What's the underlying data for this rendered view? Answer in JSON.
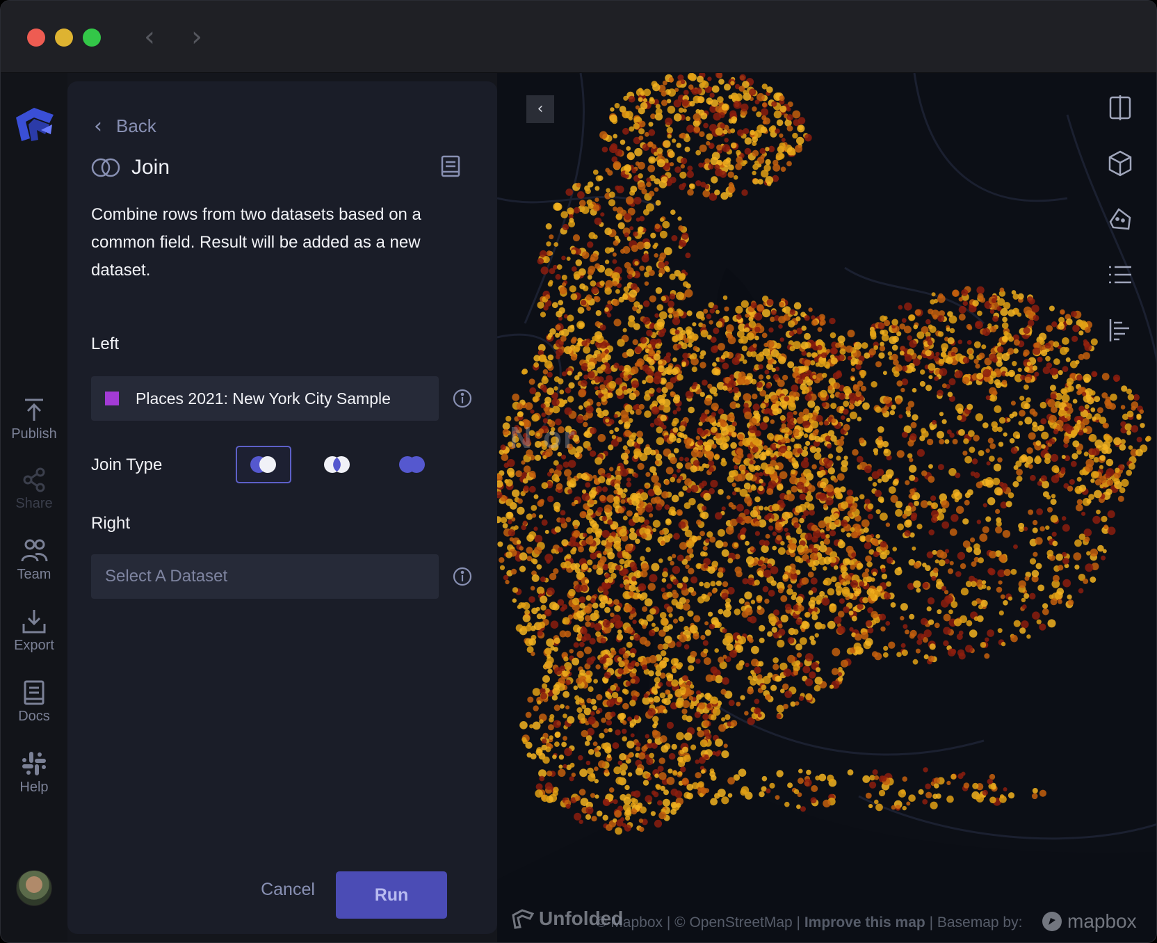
{
  "window": {
    "traffic_lights": [
      "close",
      "minimize",
      "zoom"
    ],
    "nav": {
      "back_glyph": "‹",
      "forward_glyph": "›"
    }
  },
  "rail": {
    "items": [
      {
        "label": "Publish",
        "icon": "upload-icon",
        "enabled": true
      },
      {
        "label": "Share",
        "icon": "share-icon",
        "enabled": false
      },
      {
        "label": "Team",
        "icon": "team-icon",
        "enabled": true
      },
      {
        "label": "Export",
        "icon": "download-icon",
        "enabled": true
      },
      {
        "label": "Docs",
        "icon": "book-icon",
        "enabled": true
      },
      {
        "label": "Help",
        "icon": "slack-icon",
        "enabled": true
      }
    ]
  },
  "panel": {
    "back_label": "Back",
    "title": "Join",
    "description": "Combine rows from two datasets based on a common field. Result will be added as a new dataset.",
    "left": {
      "label": "Left",
      "dataset_name": "Places 2021: New York City Sample",
      "swatch_color": "#a33bd6"
    },
    "join_type": {
      "label": "Join Type",
      "options": [
        "left-join-icon",
        "inner-join-icon",
        "outer-join-icon"
      ],
      "selected_index": 0
    },
    "right": {
      "label": "Right",
      "placeholder": "Select A Dataset"
    },
    "cancel_label": "Cancel",
    "run_label": "Run"
  },
  "map": {
    "collapse_glyph": "‹",
    "city_label": "N      or",
    "brand": "Unfolded",
    "attribution": {
      "mapbox": "© Mapbox",
      "osm": "© OpenStreetMap",
      "improve": "Improve this map",
      "basemap": "Basemap by:"
    },
    "mapbox_brand": "mapbox",
    "tools": [
      "split-map-icon",
      "3d-cube-icon",
      "draw-polygon-icon",
      "layer-list-icon",
      "legend-icon"
    ],
    "point_colors": [
      "#e2a014",
      "#c45f0d",
      "#8c1d0e",
      "#f3b320"
    ]
  }
}
